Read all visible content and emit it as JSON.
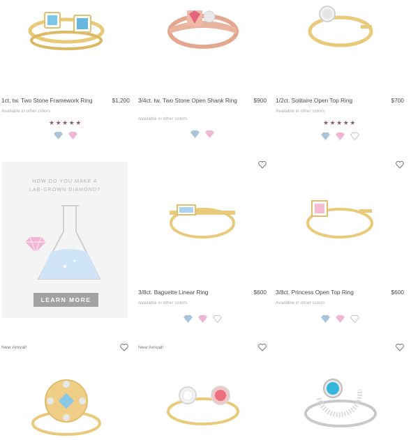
{
  "products": [
    {
      "title": "1ct. tw. Two Stone Framework Ring",
      "price": "$1,200",
      "availability": "Available in other colors",
      "rating": 5,
      "stars": "★★★★★",
      "swatches": [
        "blue-diamond-icon",
        "pink-diamond-icon"
      ]
    },
    {
      "title": "3/4ct. tw. Two Stone Open Shank Ring",
      "price": "$900",
      "availability": "Available in other colors",
      "swatches": [
        "blue-diamond-icon",
        "pink-diamond-icon"
      ]
    },
    {
      "title": "1/2ct. Solitaire Open Top Ring",
      "price": "$700",
      "availability": "Available in other colors",
      "rating": 5,
      "stars": "★★★★★",
      "swatches": [
        "blue-diamond-icon",
        "pink-diamond-icon",
        "white-diamond-icon"
      ]
    },
    {
      "title": "3/8ct. Baguette Linear Ring",
      "price": "$600",
      "availability": "Available in other colors",
      "swatches": [
        "blue-diamond-icon",
        "pink-diamond-icon",
        "white-diamond-icon"
      ]
    },
    {
      "title": "3/8ct. Princess Open Top Ring",
      "price": "$600",
      "availability": "Available in other colors",
      "swatches": [
        "blue-diamond-icon",
        "pink-diamond-icon",
        "white-diamond-icon"
      ]
    },
    {
      "badge": "New Arrival!"
    },
    {
      "badge": "New Arrival!"
    },
    {}
  ],
  "promo": {
    "question_line1": "HOW DO YOU MAKE A",
    "question_line2": "LAB-GROWN DIAMOND?",
    "button_label": "LEARN MORE"
  },
  "colors": {
    "blue_swatch": "#a9c4da",
    "pink_swatch": "#f0b6d4",
    "white_swatch": "#ffffff",
    "star": "#8a5a72",
    "button": "#a2a2a2",
    "gold": "#e9c97a"
  }
}
